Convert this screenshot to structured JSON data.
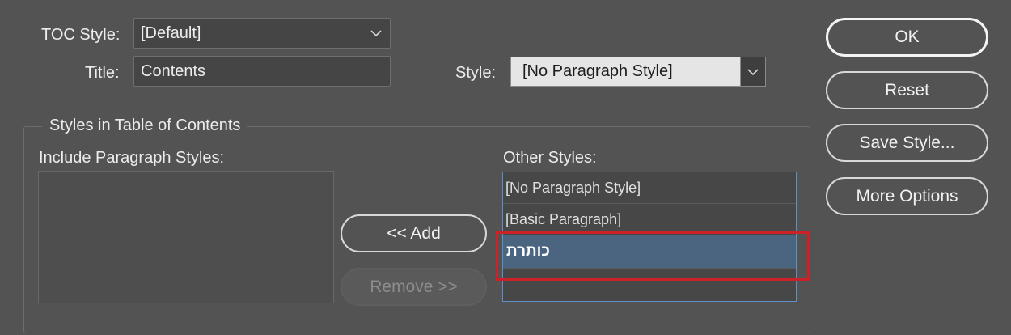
{
  "toc_style": {
    "label": "TOC Style:",
    "value": "[Default]"
  },
  "title_field": {
    "label": "Title:",
    "value": "Contents"
  },
  "style_field": {
    "label": "Style:",
    "value": "[No Paragraph Style]"
  },
  "group": {
    "legend": "Styles in Table of Contents",
    "include_label": "Include Paragraph Styles:",
    "include_items": [],
    "other_label": "Other Styles:",
    "other_items": [
      "[No Paragraph Style]",
      "[Basic Paragraph]",
      "כותרת"
    ],
    "selected_other_index": 2
  },
  "buttons": {
    "ok": "OK",
    "reset": "Reset",
    "save_style": "Save Style...",
    "more_options": "More Options",
    "add": "<< Add",
    "remove": "Remove >>"
  },
  "colors": {
    "background": "#535353",
    "selection": "#4b6580",
    "highlight_annotation": "#cc2128",
    "list_focus_border": "#5f8fc4"
  },
  "icons": {
    "dropdown": "chevron-down-icon"
  }
}
